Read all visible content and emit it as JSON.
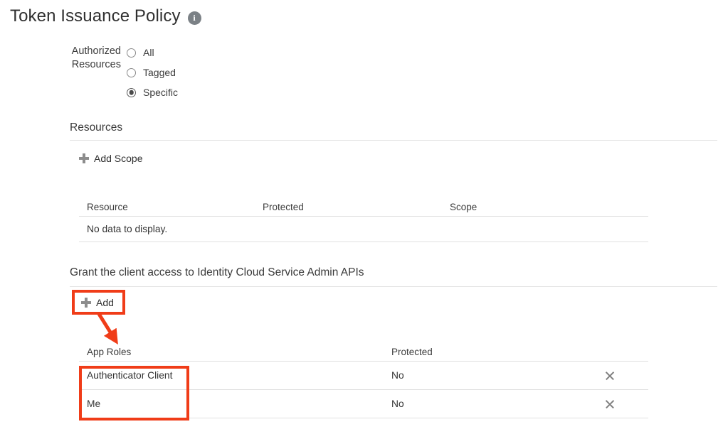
{
  "header": {
    "title": "Token Issuance Policy",
    "info_icon": "info-icon",
    "info_glyph": "i"
  },
  "authorized_resources": {
    "label": "Authorized Resources",
    "options": [
      {
        "label": "All",
        "selected": false
      },
      {
        "label": "Tagged",
        "selected": false
      },
      {
        "label": "Specific",
        "selected": true
      }
    ]
  },
  "resources_section": {
    "heading": "Resources",
    "add_scope_label": "Add Scope",
    "add_scope_icon": "plus-icon",
    "table": {
      "columns": [
        "Resource",
        "Protected",
        "Scope"
      ],
      "rows": [],
      "empty_message": "No data to display."
    }
  },
  "grant_section": {
    "heading": "Grant the client access to Identity Cloud Service Admin APIs",
    "add_label": "Add",
    "add_icon": "plus-icon",
    "table": {
      "columns": [
        "App Roles",
        "Protected",
        ""
      ],
      "rows": [
        {
          "app_role": "Authenticator Client",
          "protected": "No",
          "remove_icon": "close-x-icon"
        },
        {
          "app_role": "Me",
          "protected": "No",
          "remove_icon": "close-x-icon"
        }
      ]
    }
  },
  "annotations": {
    "color": "#f03c18",
    "highlight_add_button": true,
    "highlight_app_roles_cells": true,
    "arrow_from_add_to_app_roles": true
  }
}
